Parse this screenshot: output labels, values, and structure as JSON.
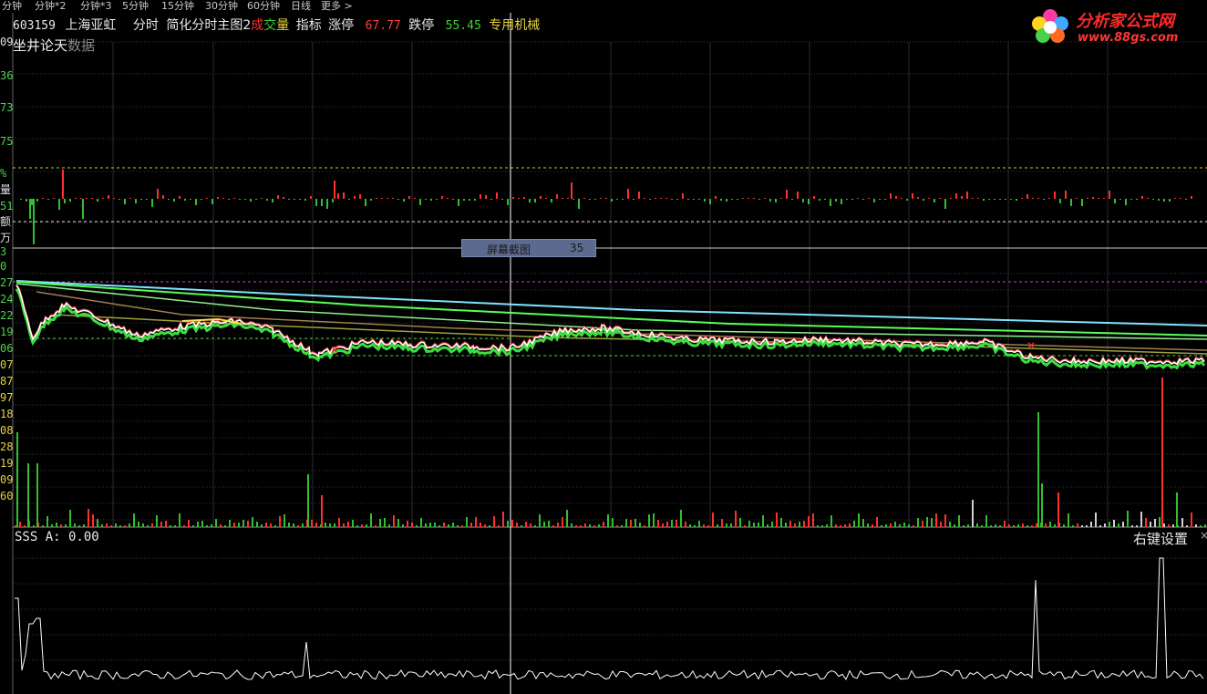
{
  "toolbar": {
    "items": [
      "分钟",
      "分钟*2",
      "分钟*3",
      "5分钟",
      "15分钟",
      "30分钟",
      "60分钟",
      "日线"
    ],
    "more": "更多 >"
  },
  "header": {
    "code": "603159",
    "name": "上海亚虹",
    "mode": "分时",
    "formula": "简化分时主图2",
    "cheng": "成",
    "jiao": "交",
    "liang": "量",
    "indicator": "指标",
    "limit_up_label": "涨停",
    "limit_up_value": "67.77",
    "limit_down_label": "跌停",
    "limit_down_value": "55.45",
    "sector": "专用机械"
  },
  "subheader": {
    "title": "坐井论天",
    "data_label": "数据"
  },
  "logo": {
    "text": "分析家公式网",
    "url": "www.88gs.com"
  },
  "left_axis": {
    "labels": [
      "09",
      "36",
      "73",
      "75",
      "%",
      "量",
      "51",
      "额",
      "万",
      "3",
      "0",
      "27",
      "24",
      "22",
      "19",
      "06",
      "07",
      "87",
      "97",
      "18",
      "08",
      "28",
      "19",
      "09",
      "60"
    ]
  },
  "popup": {
    "label": "屏幕截图",
    "count": "35"
  },
  "indicator_panel": {
    "label": "SSS A: 0.00",
    "right_click": "右键设置",
    "close": "×"
  },
  "colors": {
    "background": "#000000",
    "grid": "#3a3a3a",
    "up": "#ff3030",
    "down": "#30c030",
    "price_line": "#ffffff",
    "ma_cyan": "#7fe3ff",
    "ma_green": "#58ff58",
    "ma_yellow": "#e6d23c",
    "ma_brown": "#a08050",
    "limit_line": "#e0c040"
  }
}
